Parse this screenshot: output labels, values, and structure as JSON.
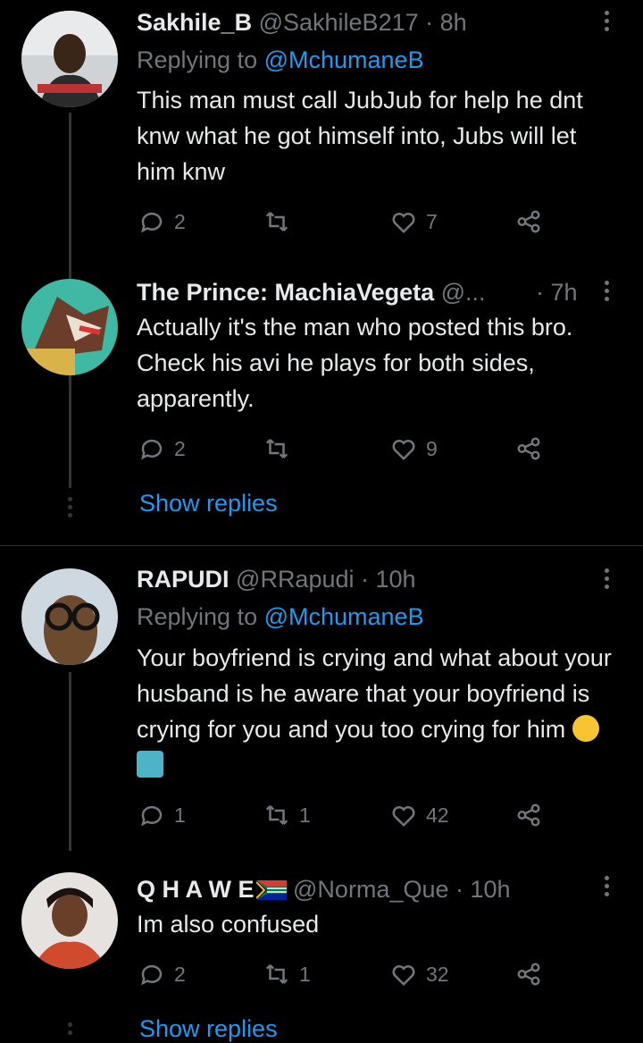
{
  "tweets": [
    {
      "name": "Sakhile_B",
      "handle": "@SakhileB217",
      "time": "· 8h",
      "replying_label": "Replying to ",
      "replying_handle": "@MchumaneB",
      "text": "This man must call JubJub for help he dnt knw what he got himself into, Jubs will let him knw",
      "replies": "2",
      "retweets": "",
      "likes": "7"
    },
    {
      "name": "The Prince: MachiaVegeta",
      "handle": "@...",
      "time": "· 7h",
      "text": "Actually it's the man who posted this bro. Check his avi he plays for both sides, apparently.",
      "replies": "2",
      "retweets": "",
      "likes": "9",
      "show_replies": "Show replies"
    },
    {
      "name": "RAPUDI",
      "handle": "@RRapudi",
      "time": "· 10h",
      "replying_label": "Replying to ",
      "replying_handle": "@MchumaneB",
      "text": "Your boyfriend is crying and what about your husband is he aware that your boyfriend is crying for you and you too crying for him",
      "replies": "1",
      "retweets": "1",
      "likes": "42"
    },
    {
      "name": "Q H A W E",
      "handle": "@Norma_Que",
      "time": "· 10h",
      "text": "Im also confused",
      "replies": "2",
      "retweets": "1",
      "likes": "32",
      "show_replies": "Show replies"
    }
  ],
  "colors": {
    "background": "#000000",
    "text": "#e7e9ea",
    "muted": "#71767b",
    "link": "#1d9bf0"
  },
  "icons": [
    "reply-icon",
    "retweet-icon",
    "like-icon",
    "share-icon",
    "more-icon",
    "flag-icon",
    "thinking-emoji",
    "shrug-emoji"
  ]
}
